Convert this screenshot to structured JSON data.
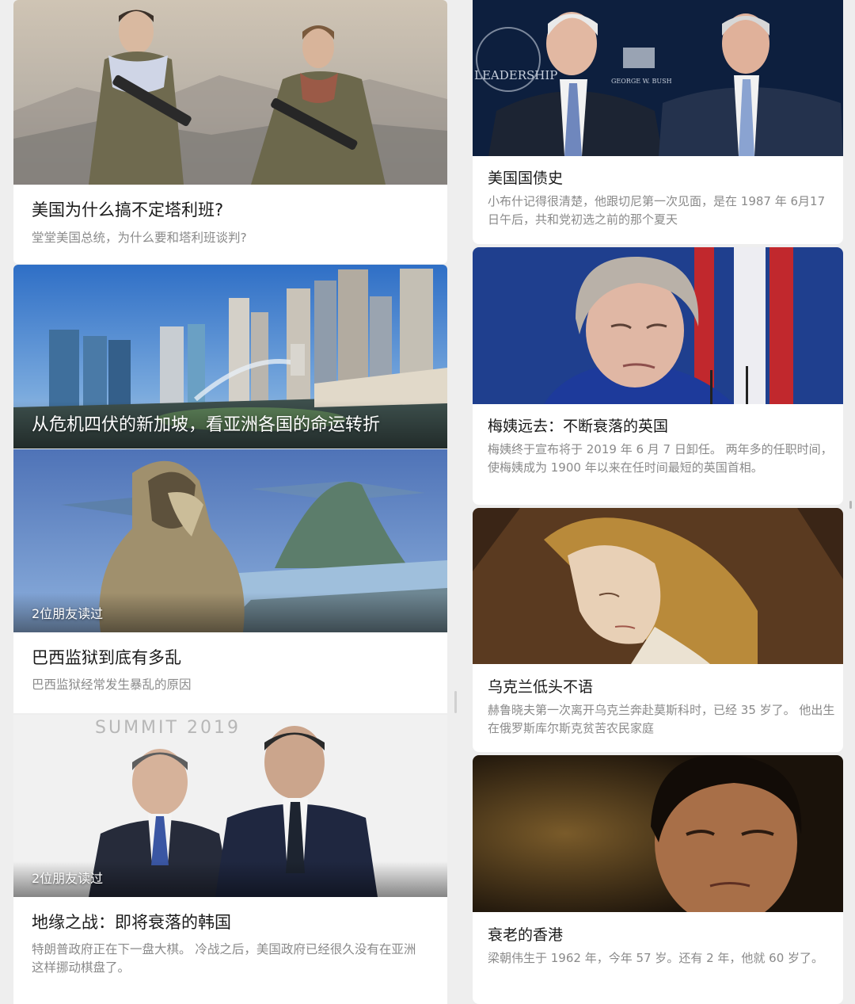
{
  "left_cards": [
    {
      "title": "美国为什么搞不定塔利班?",
      "desc": "堂堂美国总统，为什么要和塔利班谈判?",
      "image": "soldiers-photo"
    },
    {
      "overlay_title": "从危机四伏的新加坡，看亚洲各国的命运转折",
      "image": "singapore-skyline-photo"
    },
    {
      "read_badge": "2位朋友读过",
      "title": "巴西监狱到底有多乱",
      "desc": "巴西监狱经常发生暴乱的原因",
      "image": "rio-statue-illustration"
    },
    {
      "read_badge": "2位朋友读过",
      "title": "地缘之战：即将衰落的韩国",
      "desc": "特朗普政府正在下一盘大棋。 冷战之后，美国政府已经很久没有在亚洲这样挪动棋盘了。",
      "image": "summit-leaders-photo",
      "image_text": "SUMMIT 2019"
    }
  ],
  "right_cards": [
    {
      "title": "美国国债史",
      "desc": "小布什记得很清楚，他跟切尼第一次见面，是在 1987 年 6月17日午后，共和党初选之前的那个夏天",
      "image": "presidents-photo",
      "image_text_1": "LEADERSHIP",
      "image_text_2": "GEORGE W. BUSH"
    },
    {
      "title": "梅姨远去：不断衰落的英国",
      "desc": "梅姨终于宣布将于 2019 年 6 月 7 日卸任。 两年多的任职时间，使梅姨成为 1900 年以来在任时间最短的英国首相。",
      "image": "theresa-may-photo"
    },
    {
      "title": "乌克兰低头不语",
      "desc": "赫鲁晓夫第一次离开乌克兰奔赴莫斯科时，已经 35 岁了。 他出生在俄罗斯库尔斯克贫苦农民家庭",
      "image": "madonna-painting"
    },
    {
      "title": "衰老的香港",
      "desc": "梁朝伟生于 1962 年，今年 57 岁。还有 2 年，他就 60 岁了。",
      "image": "actor-film-still"
    }
  ]
}
